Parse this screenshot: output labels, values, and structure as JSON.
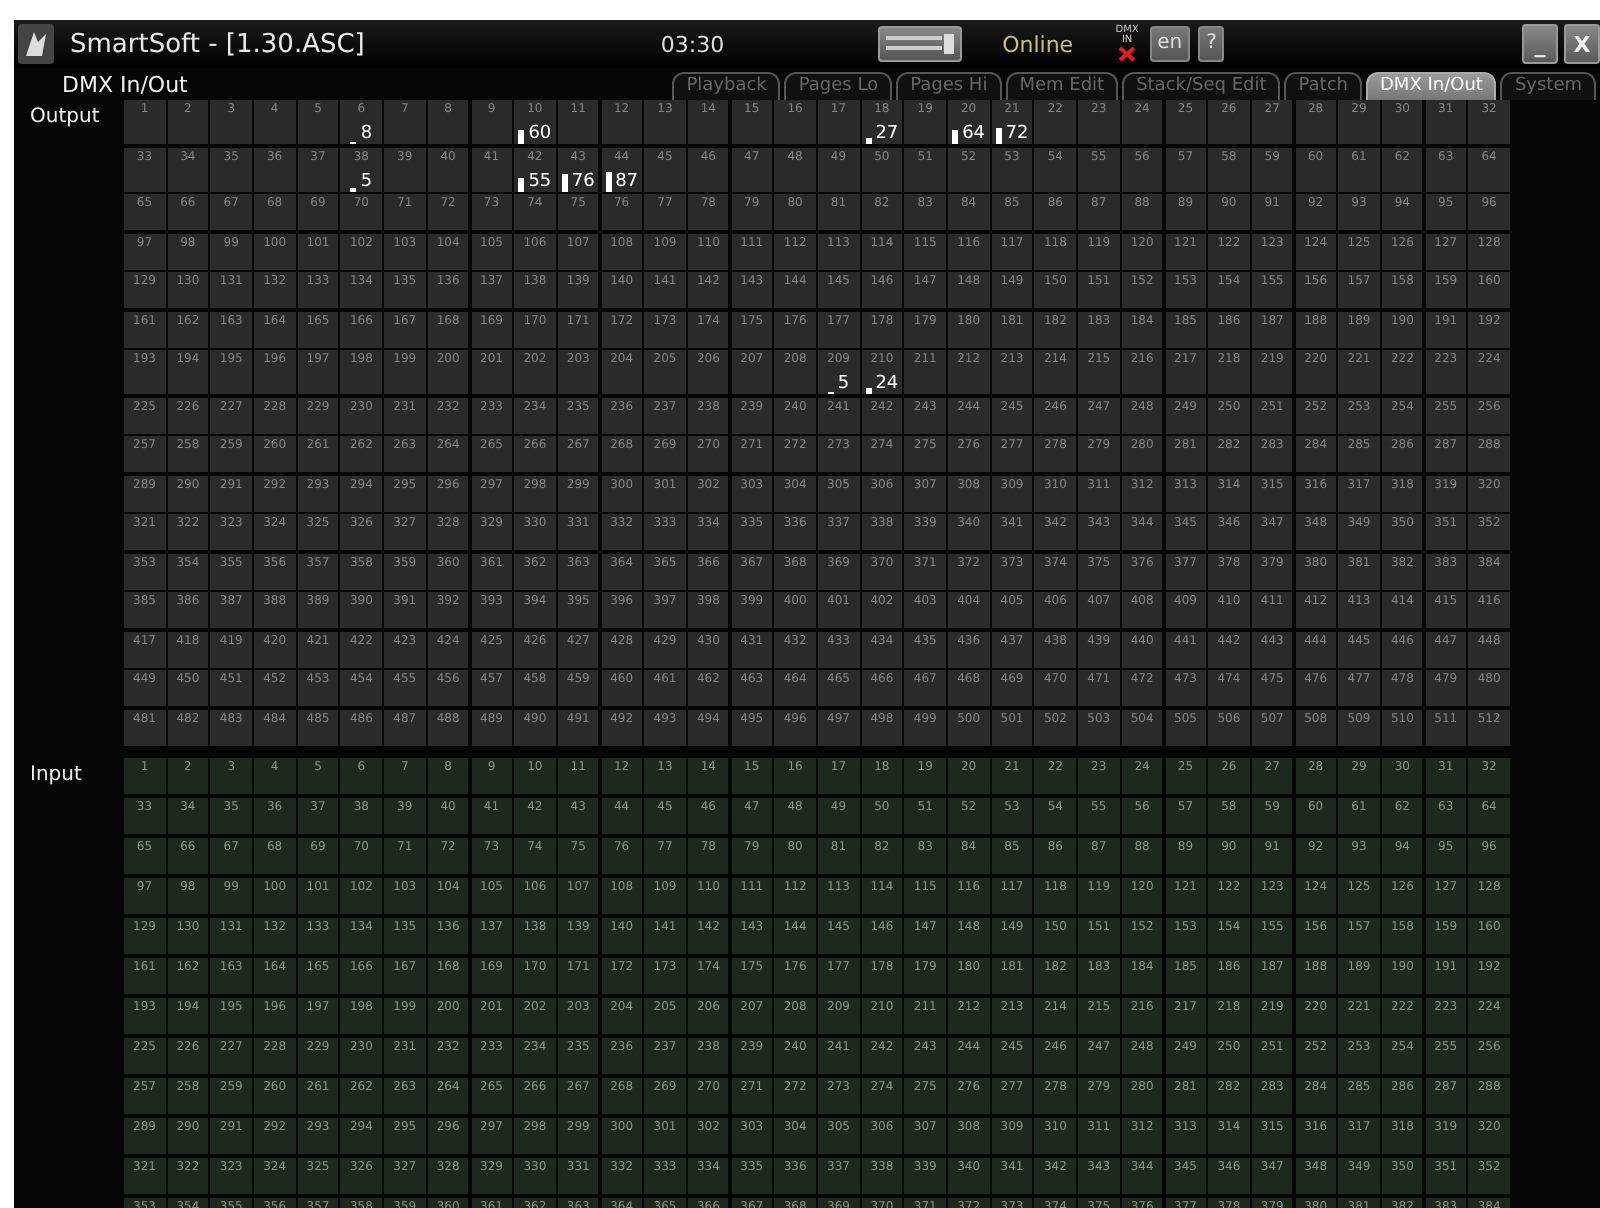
{
  "window": {
    "title": "SmartSoft - [1.30.ASC]",
    "time": "03:30",
    "status": "Online",
    "dmx_in_label": "DMX IN",
    "language": "en",
    "help": "?",
    "minimize": "_",
    "close": "X"
  },
  "page_title": "DMX In/Out",
  "tabs": [
    {
      "label": "Playback",
      "selected": false
    },
    {
      "label": "Pages Lo",
      "selected": false
    },
    {
      "label": "Pages Hi",
      "selected": false
    },
    {
      "label": "Mem Edit",
      "selected": false
    },
    {
      "label": "Stack/Seq Edit",
      "selected": false
    },
    {
      "label": "Patch",
      "selected": false
    },
    {
      "label": "DMX In/Out",
      "selected": true
    },
    {
      "label": "System",
      "selected": false
    }
  ],
  "output": {
    "label": "Output",
    "rows": [
      [
        "1",
        "2",
        "3",
        "4",
        "5",
        {
          "channel": "6",
          "value": "8"
        },
        "7",
        "8",
        "9",
        {
          "channel": "10",
          "value": "60"
        },
        "11",
        "12",
        "13",
        "14",
        "15",
        "16",
        "17",
        {
          "channel": "18",
          "value": "27"
        },
        "19",
        {
          "channel": "20",
          "value": "64"
        },
        {
          "channel": "21",
          "value": "72"
        },
        "22",
        "23",
        "24",
        "25",
        "26",
        "27",
        "28",
        "29",
        "30",
        "31",
        "32"
      ],
      [
        "33",
        "34",
        "35",
        "36",
        "37",
        {
          "channel": "38",
          "value": "5"
        },
        "39",
        "40",
        "41",
        {
          "channel": "42",
          "value": "55"
        },
        {
          "channel": "43",
          "value": "76"
        },
        {
          "channel": "44",
          "value": "87"
        },
        "45",
        "46",
        "47",
        "48",
        "49",
        "50",
        "51",
        "52",
        "53",
        "54",
        "55",
        "56",
        "57",
        "58",
        "59",
        "60",
        "61",
        "62",
        "63",
        "64"
      ],
      [
        "65",
        "66",
        "67",
        "68",
        "69",
        "70",
        "71",
        "72",
        "73",
        "74",
        "75",
        "76",
        "77",
        "78",
        "79",
        "80",
        "81",
        "82",
        "83",
        "84",
        "85",
        "86",
        "87",
        "88",
        "89",
        "90",
        "91",
        "92",
        "93",
        "94",
        "95",
        "96"
      ],
      [
        "97",
        "98",
        "99",
        "100",
        "101",
        "102",
        "103",
        "104",
        "105",
        "106",
        "107",
        "108",
        "109",
        "110",
        "111",
        "112",
        "113",
        "114",
        "115",
        "116",
        "117",
        "118",
        "119",
        "120",
        "121",
        "122",
        "123",
        "124",
        "125",
        "126",
        "127",
        "128"
      ],
      [
        "129",
        "130",
        "131",
        "132",
        "133",
        "134",
        "135",
        "136",
        "137",
        "138",
        "139",
        "140",
        "141",
        "142",
        "143",
        "144",
        "145",
        "146",
        "147",
        "148",
        "149",
        "150",
        "151",
        "152",
        "153",
        "154",
        "155",
        "156",
        "157",
        "158",
        "159",
        "160"
      ],
      [
        "161",
        "162",
        "163",
        "164",
        "165",
        "166",
        "167",
        "168",
        "169",
        "170",
        "171",
        "172",
        "173",
        "174",
        "175",
        "176",
        "177",
        "178",
        "179",
        "180",
        "181",
        "182",
        "183",
        "184",
        "185",
        "186",
        "187",
        "188",
        "189",
        "190",
        "191",
        "192"
      ],
      [
        "193",
        "194",
        "195",
        "196",
        "197",
        "198",
        "199",
        "200",
        "201",
        "202",
        "203",
        "204",
        "205",
        "206",
        "207",
        "208",
        {
          "channel": "209",
          "value": "5"
        },
        {
          "channel": "210",
          "value": "24"
        },
        "211",
        "212",
        "213",
        "214",
        "215",
        "216",
        "217",
        "218",
        "219",
        "220",
        "221",
        "222",
        "223",
        "224"
      ],
      [
        "225",
        "226",
        "227",
        "228",
        "229",
        "230",
        "231",
        "232",
        "233",
        "234",
        "235",
        "236",
        "237",
        "238",
        "239",
        "240",
        "241",
        "242",
        "243",
        "244",
        "245",
        "246",
        "247",
        "248",
        "249",
        "250",
        "251",
        "252",
        "253",
        "254",
        "255",
        "256"
      ],
      [
        "257",
        "258",
        "259",
        "260",
        "261",
        "262",
        "263",
        "264",
        "265",
        "266",
        "267",
        "268",
        "269",
        "270",
        "271",
        "272",
        "273",
        "274",
        "275",
        "276",
        "277",
        "278",
        "279",
        "280",
        "281",
        "282",
        "283",
        "284",
        "285",
        "286",
        "287",
        "288"
      ],
      [
        "289",
        "290",
        "291",
        "292",
        "293",
        "294",
        "295",
        "296",
        "297",
        "298",
        "299",
        "300",
        "301",
        "302",
        "303",
        "304",
        "305",
        "306",
        "307",
        "308",
        "309",
        "310",
        "311",
        "312",
        "313",
        "314",
        "315",
        "316",
        "317",
        "318",
        "319",
        "320"
      ],
      [
        "321",
        "322",
        "323",
        "324",
        "325",
        "326",
        "327",
        "328",
        "329",
        "330",
        "331",
        "332",
        "333",
        "334",
        "335",
        "336",
        "337",
        "338",
        "339",
        "340",
        "341",
        "342",
        "343",
        "344",
        "345",
        "346",
        "347",
        "348",
        "349",
        "350",
        "351",
        "352"
      ],
      [
        "353",
        "354",
        "355",
        "356",
        "357",
        "358",
        "359",
        "360",
        "361",
        "362",
        "363",
        "364",
        "365",
        "366",
        "367",
        "368",
        "369",
        "370",
        "371",
        "372",
        "373",
        "374",
        "375",
        "376",
        "377",
        "378",
        "379",
        "380",
        "381",
        "382",
        "383",
        "384"
      ],
      [
        "385",
        "386",
        "387",
        "388",
        "389",
        "390",
        "391",
        "392",
        "393",
        "394",
        "395",
        "396",
        "397",
        "398",
        "399",
        "400",
        "401",
        "402",
        "403",
        "404",
        "405",
        "406",
        "407",
        "408",
        "409",
        "410",
        "411",
        "412",
        "413",
        "414",
        "415",
        "416"
      ],
      [
        "417",
        "418",
        "419",
        "420",
        "421",
        "422",
        "423",
        "424",
        "425",
        "426",
        "427",
        "428",
        "429",
        "430",
        "431",
        "432",
        "433",
        "434",
        "435",
        "436",
        "437",
        "438",
        "439",
        "440",
        "441",
        "442",
        "443",
        "444",
        "445",
        "446",
        "447",
        "448"
      ],
      [
        "449",
        "450",
        "451",
        "452",
        "453",
        "454",
        "455",
        "456",
        "457",
        "458",
        "459",
        "460",
        "461",
        "462",
        "463",
        "464",
        "465",
        "466",
        "467",
        "468",
        "469",
        "470",
        "471",
        "472",
        "473",
        "474",
        "475",
        "476",
        "477",
        "478",
        "479",
        "480"
      ],
      [
        "481",
        "482",
        "483",
        "484",
        "485",
        "486",
        "487",
        "488",
        "489",
        "490",
        "491",
        "492",
        "493",
        "494",
        "495",
        "496",
        "497",
        "498",
        "499",
        "500",
        "501",
        "502",
        "503",
        "504",
        "505",
        "506",
        "507",
        "508",
        "509",
        "510",
        "511",
        "512"
      ]
    ]
  },
  "input": {
    "label": "Input",
    "rows": [
      [
        "1",
        "2",
        "3",
        "4",
        "5",
        "6",
        "7",
        "8",
        "9",
        "10",
        "11",
        "12",
        "13",
        "14",
        "15",
        "16",
        "17",
        "18",
        "19",
        "20",
        "21",
        "22",
        "23",
        "24",
        "25",
        "26",
        "27",
        "28",
        "29",
        "30",
        "31",
        "32"
      ],
      [
        "33",
        "34",
        "35",
        "36",
        "37",
        "38",
        "39",
        "40",
        "41",
        "42",
        "43",
        "44",
        "45",
        "46",
        "47",
        "48",
        "49",
        "50",
        "51",
        "52",
        "53",
        "54",
        "55",
        "56",
        "57",
        "58",
        "59",
        "60",
        "61",
        "62",
        "63",
        "64"
      ],
      [
        "65",
        "66",
        "67",
        "68",
        "69",
        "70",
        "71",
        "72",
        "73",
        "74",
        "75",
        "76",
        "77",
        "78",
        "79",
        "80",
        "81",
        "82",
        "83",
        "84",
        "85",
        "86",
        "87",
        "88",
        "89",
        "90",
        "91",
        "92",
        "93",
        "94",
        "95",
        "96"
      ],
      [
        "97",
        "98",
        "99",
        "100",
        "101",
        "102",
        "103",
        "104",
        "105",
        "106",
        "107",
        "108",
        "109",
        "110",
        "111",
        "112",
        "113",
        "114",
        "115",
        "116",
        "117",
        "118",
        "119",
        "120",
        "121",
        "122",
        "123",
        "124",
        "125",
        "126",
        "127",
        "128"
      ],
      [
        "129",
        "130",
        "131",
        "132",
        "133",
        "134",
        "135",
        "136",
        "137",
        "138",
        "139",
        "140",
        "141",
        "142",
        "143",
        "144",
        "145",
        "146",
        "147",
        "148",
        "149",
        "150",
        "151",
        "152",
        "153",
        "154",
        "155",
        "156",
        "157",
        "158",
        "159",
        "160"
      ],
      [
        "161",
        "162",
        "163",
        "164",
        "165",
        "166",
        "167",
        "168",
        "169",
        "170",
        "171",
        "172",
        "173",
        "174",
        "175",
        "176",
        "177",
        "178",
        "179",
        "180",
        "181",
        "182",
        "183",
        "184",
        "185",
        "186",
        "187",
        "188",
        "189",
        "190",
        "191",
        "192"
      ],
      [
        "193",
        "194",
        "195",
        "196",
        "197",
        "198",
        "199",
        "200",
        "201",
        "202",
        "203",
        "204",
        "205",
        "206",
        "207",
        "208",
        "209",
        "210",
        "211",
        "212",
        "213",
        "214",
        "215",
        "216",
        "217",
        "218",
        "219",
        "220",
        "221",
        "222",
        "223",
        "224"
      ],
      [
        "225",
        "226",
        "227",
        "228",
        "229",
        "230",
        "231",
        "232",
        "233",
        "234",
        "235",
        "236",
        "237",
        "238",
        "239",
        "240",
        "241",
        "242",
        "243",
        "244",
        "245",
        "246",
        "247",
        "248",
        "249",
        "250",
        "251",
        "252",
        "253",
        "254",
        "255",
        "256"
      ],
      [
        "257",
        "258",
        "259",
        "260",
        "261",
        "262",
        "263",
        "264",
        "265",
        "266",
        "267",
        "268",
        "269",
        "270",
        "271",
        "272",
        "273",
        "274",
        "275",
        "276",
        "277",
        "278",
        "279",
        "280",
        "281",
        "282",
        "283",
        "284",
        "285",
        "286",
        "287",
        "288"
      ],
      [
        "289",
        "290",
        "291",
        "292",
        "293",
        "294",
        "295",
        "296",
        "297",
        "298",
        "299",
        "300",
        "301",
        "302",
        "303",
        "304",
        "305",
        "306",
        "307",
        "308",
        "309",
        "310",
        "311",
        "312",
        "313",
        "314",
        "315",
        "316",
        "317",
        "318",
        "319",
        "320"
      ],
      [
        "321",
        "322",
        "323",
        "324",
        "325",
        "326",
        "327",
        "328",
        "329",
        "330",
        "331",
        "332",
        "333",
        "334",
        "335",
        "336",
        "337",
        "338",
        "339",
        "340",
        "341",
        "342",
        "343",
        "344",
        "345",
        "346",
        "347",
        "348",
        "349",
        "350",
        "351",
        "352"
      ],
      [
        "353",
        "354",
        "355",
        "356",
        "357",
        "358",
        "359",
        "360",
        "361",
        "362",
        "363",
        "364",
        "365",
        "366",
        "367",
        "368",
        "369",
        "370",
        "371",
        "372",
        "373",
        "374",
        "375",
        "376",
        "377",
        "378",
        "379",
        "380",
        "381",
        "382",
        "383",
        "384"
      ]
    ]
  }
}
